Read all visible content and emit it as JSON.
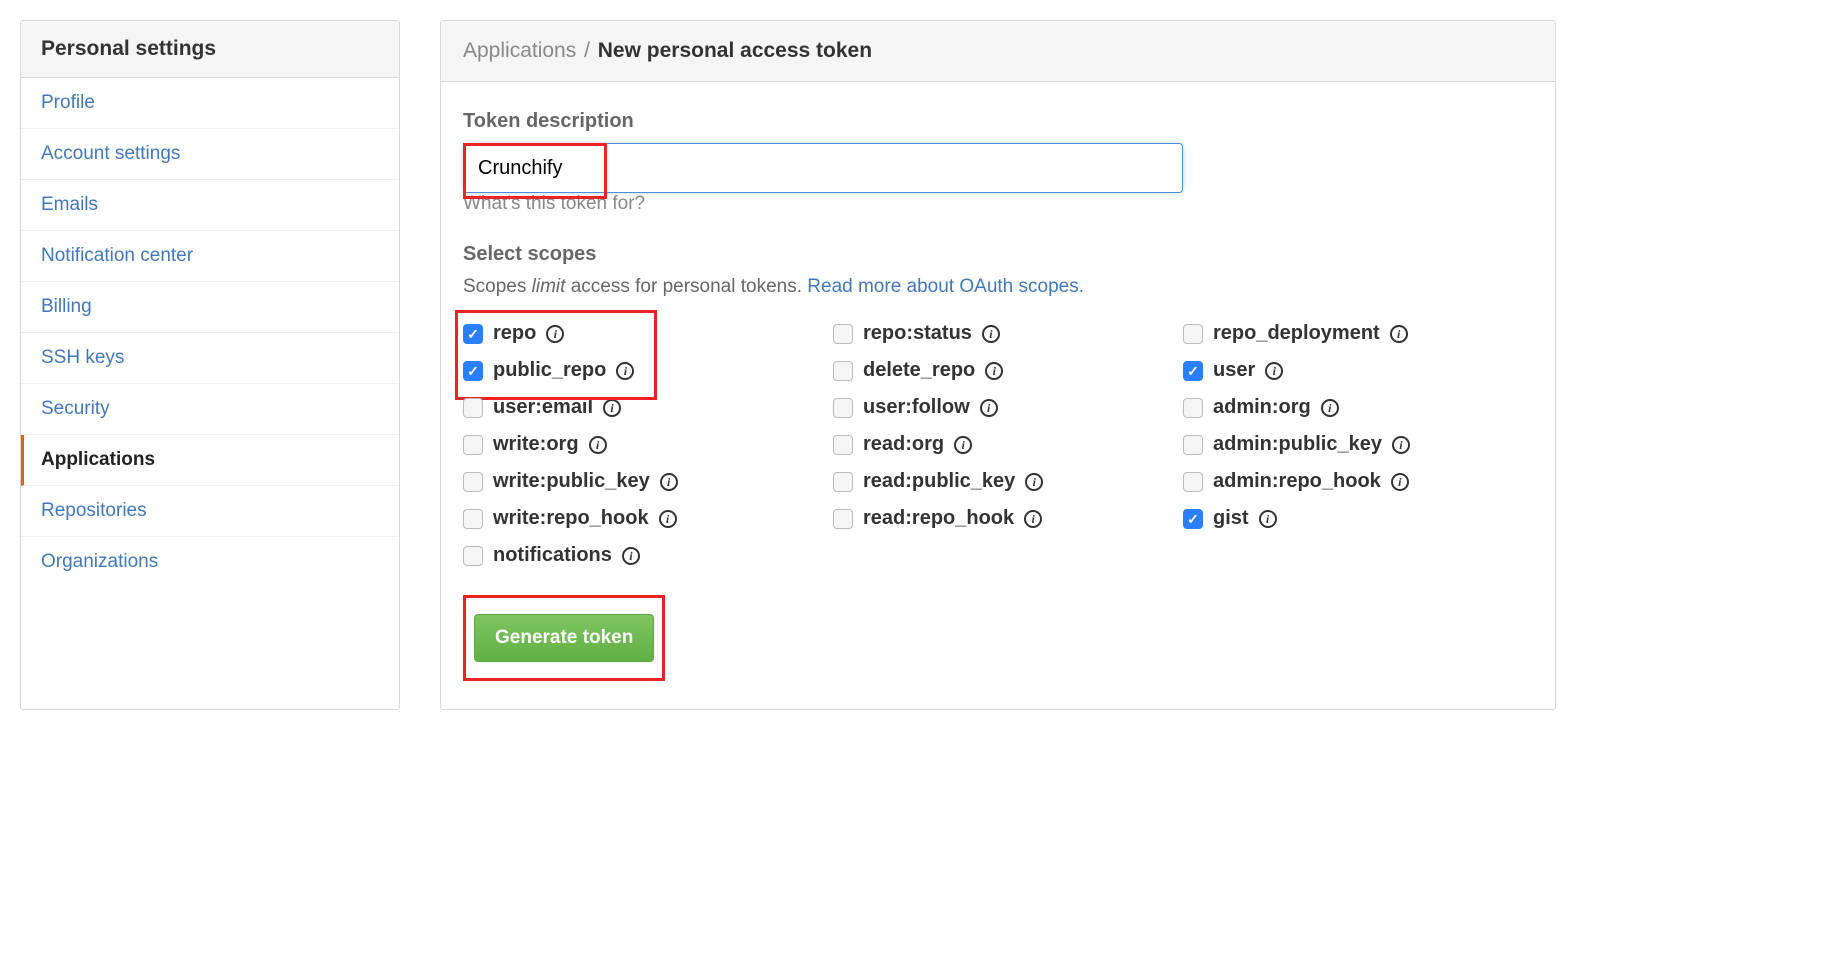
{
  "sidebar": {
    "header": "Personal settings",
    "items": [
      {
        "label": "Profile",
        "active": false
      },
      {
        "label": "Account settings",
        "active": false
      },
      {
        "label": "Emails",
        "active": false
      },
      {
        "label": "Notification center",
        "active": false
      },
      {
        "label": "Billing",
        "active": false
      },
      {
        "label": "SSH keys",
        "active": false
      },
      {
        "label": "Security",
        "active": false
      },
      {
        "label": "Applications",
        "active": true
      },
      {
        "label": "Repositories",
        "active": false
      },
      {
        "label": "Organizations",
        "active": false
      }
    ]
  },
  "breadcrumb": {
    "parent": "Applications",
    "sep": "/",
    "current": "New personal access token"
  },
  "form": {
    "token_label": "Token description",
    "token_value": "Crunchify",
    "help_text": "What's this token for?",
    "scopes_label": "Select scopes",
    "scopes_desc_pre": "Scopes ",
    "scopes_desc_limit": "limit",
    "scopes_desc_post": " access for personal tokens. ",
    "scopes_link": "Read more about OAuth scopes.",
    "generate_label": "Generate token"
  },
  "scopes": [
    {
      "label": "repo",
      "checked": true
    },
    {
      "label": "repo:status",
      "checked": false
    },
    {
      "label": "repo_deployment",
      "checked": false
    },
    {
      "label": "public_repo",
      "checked": true
    },
    {
      "label": "delete_repo",
      "checked": false
    },
    {
      "label": "user",
      "checked": true
    },
    {
      "label": "user:email",
      "checked": false
    },
    {
      "label": "user:follow",
      "checked": false
    },
    {
      "label": "admin:org",
      "checked": false
    },
    {
      "label": "write:org",
      "checked": false
    },
    {
      "label": "read:org",
      "checked": false
    },
    {
      "label": "admin:public_key",
      "checked": false
    },
    {
      "label": "write:public_key",
      "checked": false
    },
    {
      "label": "read:public_key",
      "checked": false
    },
    {
      "label": "admin:repo_hook",
      "checked": false
    },
    {
      "label": "write:repo_hook",
      "checked": false
    },
    {
      "label": "read:repo_hook",
      "checked": false
    },
    {
      "label": "gist",
      "checked": true
    },
    {
      "label": "notifications",
      "checked": false
    }
  ]
}
